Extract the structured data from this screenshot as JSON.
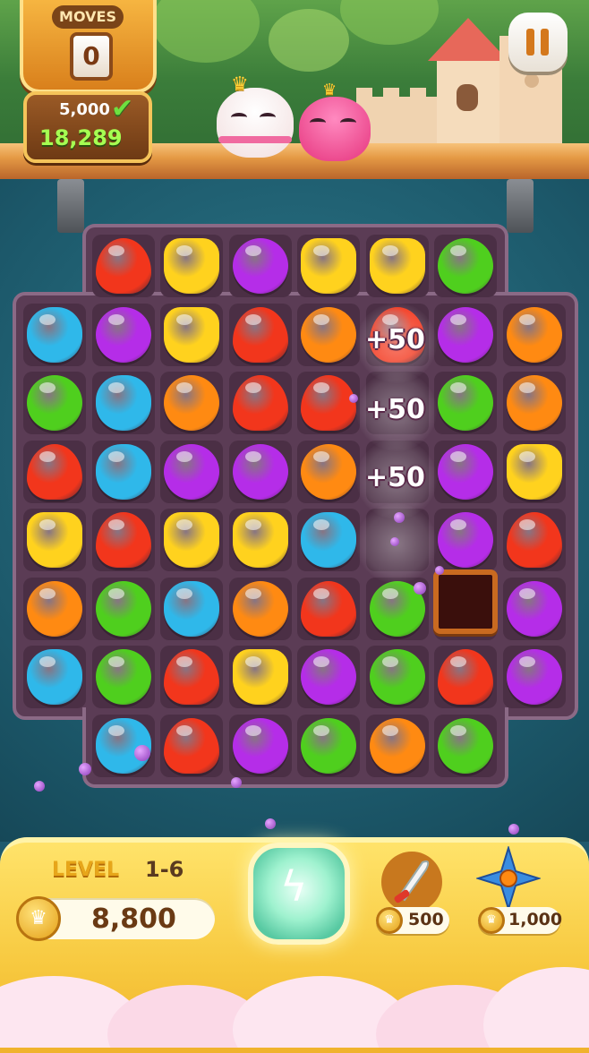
{
  "hud_top": {
    "moves_label": "MOVES",
    "moves_value": "0",
    "target_score": "5,000",
    "current_score": "18,289"
  },
  "board": {
    "gem_colors": {
      "red": "#f2361c",
      "yellow": "#ffd21e",
      "purple": "#b52de8",
      "green": "#4fcf1e",
      "blue": "#2fb8ea",
      "orange": "#ff8a12"
    },
    "rows": [
      [
        "",
        "red",
        "yellow",
        "purple",
        "yellow",
        "yellow",
        "green",
        ""
      ],
      [
        "blue",
        "purple",
        "yellow",
        "red",
        "orange",
        "red",
        "purple",
        "orange"
      ],
      [
        "green",
        "blue",
        "orange",
        "red",
        "red",
        "",
        "green",
        "orange"
      ],
      [
        "red",
        "blue",
        "purple",
        "purple",
        "orange",
        "",
        "purple",
        "yellow"
      ],
      [
        "yellow",
        "red",
        "yellow",
        "yellow",
        "blue",
        "",
        "purple",
        "red"
      ],
      [
        "orange",
        "green",
        "blue",
        "orange",
        "red",
        "green",
        "",
        "purple"
      ],
      [
        "blue",
        "green",
        "red",
        "yellow",
        "purple",
        "green",
        "red",
        "purple"
      ],
      [
        "",
        "blue",
        "red",
        "purple",
        "green",
        "orange",
        "green",
        ""
      ]
    ],
    "score_popups": [
      "+50",
      "+50",
      "+50"
    ]
  },
  "hud_bottom": {
    "level_label": "LEVEL",
    "level_value": "1-6",
    "coins": "8,800",
    "tools": [
      {
        "icon": "sword-icon",
        "price": "500"
      },
      {
        "icon": "shuriken-icon",
        "price": "1,000"
      }
    ]
  }
}
